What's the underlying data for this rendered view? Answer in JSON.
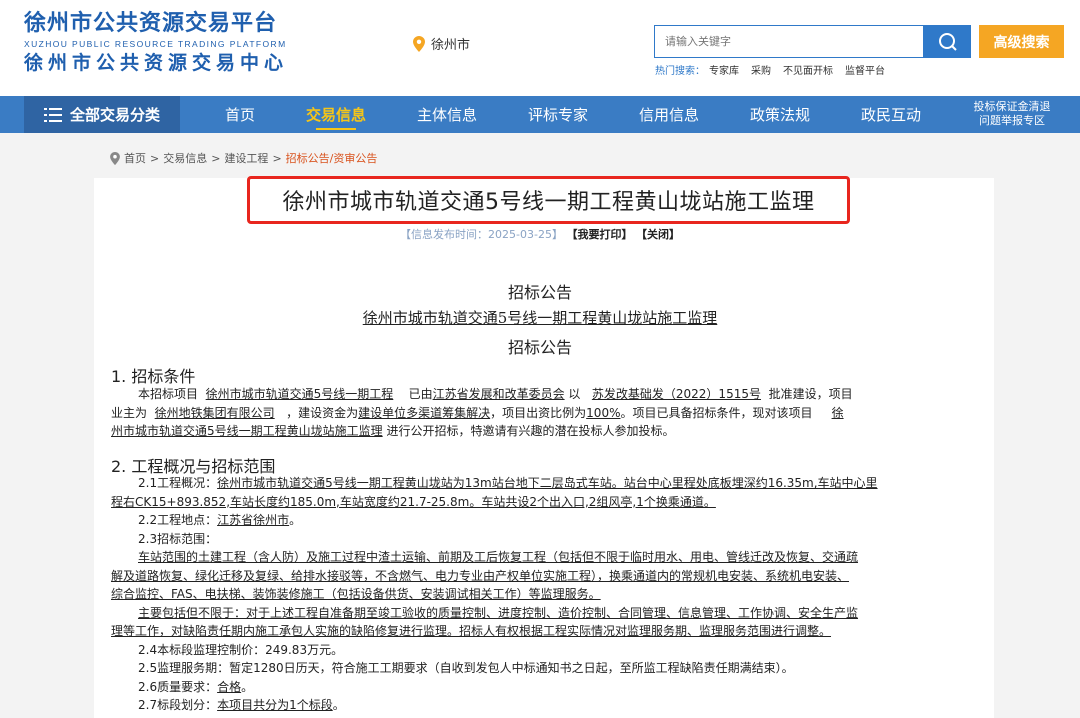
{
  "header": {
    "logo_cn_top": "徐州市公共资源交易平台",
    "logo_en": "XUZHOU PUBLIC RESOURCE TRADING PLATFORM",
    "logo_cn_bottom": "徐州市公共资源交易中心",
    "city": "徐州市",
    "search_placeholder": "请输入关键字",
    "advanced_search": "高级搜索",
    "hot_label": "热门搜索：",
    "hot_keywords": [
      "专家库",
      "采购",
      "不见面开标",
      "监督平台"
    ]
  },
  "nav": {
    "all_label": "全部交易分类",
    "items": [
      "首页",
      "交易信息",
      "主体信息",
      "评标专家",
      "信用信息",
      "政策法规",
      "政民互动"
    ],
    "active": "交易信息",
    "extra_line1": "投标保证金清退",
    "extra_line2": "问题举报专区"
  },
  "breadcrumb": {
    "items": [
      "首页",
      "交易信息",
      "建设工程",
      "招标公告/资审公告"
    ],
    "sep": ">"
  },
  "article": {
    "title": "徐州市城市轨道交通5号线一期工程黄山垅站施工监理",
    "meta_prefix": "【信息发布时间：2025-03-25】",
    "print": "【我要打印】",
    "close": "【关闭】",
    "heading": "招标公告",
    "project_name": "徐州市城市轨道交通5号线一期工程黄山垅站施工监理",
    "subheading": "招标公告",
    "sections": {
      "s1_title": "1. 招标条件",
      "s1_p1": "本招标项目",
      "s1_p2": "徐州市城市轨道交通5号线一期工程",
      "s1_p3": "已由",
      "s1_p4": "江苏省发展和改革委员会",
      "s1_p5": "以",
      "s1_p6": "苏发改基础发（2022）1515号",
      "s1_p7": "批准建设，项目",
      "s1_p8": "业主为",
      "s1_p9": "徐州地铁集团有限公司",
      "s1_p10": "，建设资金为",
      "s1_p11": "建设单位多渠道筹集解决",
      "s1_p12": "，项目出资比例为",
      "s1_p13": "100%",
      "s1_p14": "。项目已具备招标条件，现对该项目",
      "s1_p15": "徐",
      "s1_p16": "州市城市轨道交通5号线一期工程黄山垅站施工监理",
      "s1_p17": "进行公开招标，特邀请有兴趣的潜在投标人参加投标。",
      "s2_title": "2. 工程概况与招标范围",
      "s2_1_label": "2.1工程概况：",
      "s2_1_l1": "徐州市城市轨道交通5号线一期工程黄山垅站为13m站台地下二层岛式车站。站台中心里程处底板埋深约16.35m,车站中心里",
      "s2_1_l2": "程右CK15+893.852,车站长度约185.0m,车站宽度约21.7-25.8m。车站共设2个出入口,2组风亭,1个换乘通道。",
      "s2_2_label": "2.2工程地点：",
      "s2_2_val": "江苏省徐州市",
      "s2_2_end": "。",
      "s2_3_label": "2.3招标范围：",
      "s2_3_l1": "车站范围的土建工程（含人防）及施工过程中渣土运输、前期及工后恢复工程（包括但不限于临时用水、用电、管线迁改及恢复、交通疏",
      "s2_3_l2": "解及道路恢复、绿化迁移及复绿、给排水接驳等，不含燃气、电力专业由产权单位实施工程），换乘通道内的常规机电安装、系统机电安装、",
      "s2_3_l3": "综合监控、FAS、电扶梯、装饰装修施工（包括设备供货、安装调试相关工作）等监理服务。",
      "s2_3_l4": "主要包括但不限于：对于上述工程自准备期至竣工验收的质量控制、进度控制、造价控制、合同管理、信息管理、工作协调、安全生产监",
      "s2_3_l5": "理等工作，对缺陷责任期内施工承包人实施的缺陷修复进行监理。招标人有权根据工程实际情况对监理服务期、监理服务范围进行调整。",
      "s2_4": "2.4本标段监理控制价：249.83万元。",
      "s2_5": "2.5监理服务期：暂定1280日历天，符合施工工期要求（自收到发包人中标通知书之日起，至所监工程缺陷责任期满结束）。",
      "s2_6_label": "2.6质量要求：",
      "s2_6_val": "合格",
      "s2_6_end": "。",
      "s2_7_label": "2.7标段划分：",
      "s2_7_val": "本项目共分为1个标段",
      "s2_7_end": "。"
    }
  },
  "colors": {
    "brand_blue": "#1f5fae",
    "nav_blue": "#3a7cc4",
    "accent_orange": "#f5a623",
    "highlight_red": "#e8261e"
  }
}
